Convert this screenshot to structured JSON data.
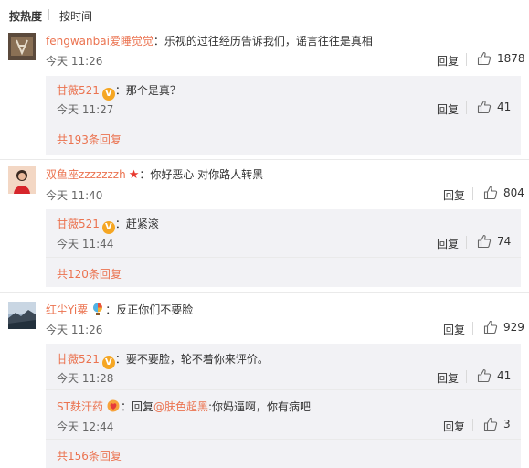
{
  "sort": {
    "hot": "按热度",
    "time": "按时间"
  },
  "actions": {
    "reply": "回复"
  },
  "comments": [
    {
      "user": "fengwanbai爱睡觉觉",
      "text": "：乐视的过往经历告诉我们，谣言往往是真相",
      "time": "今天 11:26",
      "likes": "1878",
      "replies": [
        {
          "user": "甘薇521",
          "text": "：那个是真？",
          "time": "今天 11:27",
          "likes": "41"
        }
      ],
      "more": "共193条回复"
    },
    {
      "user": "双鱼座zzzzzzzh",
      "text": "：你好恶心 对你路人转黑",
      "time": "今天 11:40",
      "likes": "804",
      "replies": [
        {
          "user": "甘薇521",
          "text": "：赶紧滚",
          "time": "今天 11:44",
          "likes": "74"
        }
      ],
      "more": "共120条回复"
    },
    {
      "user": "红尘Yi粟",
      "text": "：反正你们不要脸",
      "time": "今天 11:26",
      "likes": "929",
      "replies": [
        {
          "user": "甘薇521",
          "text": "：要不要脸，轮不着你来评价。",
          "time": "今天 11:28",
          "likes": "41"
        },
        {
          "user": "ST麸汗药",
          "text_prefix": "：回复",
          "mention": "@肤色超黑",
          "text": ":你妈逼啊，你有病吧",
          "time": "今天 12:44",
          "likes": "3"
        }
      ],
      "more": "共156条回复"
    }
  ],
  "colors": {
    "username": "#eb7350",
    "reply_bg": "#f2f2f5",
    "badge": "#f5a623",
    "star": "#e8392e"
  }
}
